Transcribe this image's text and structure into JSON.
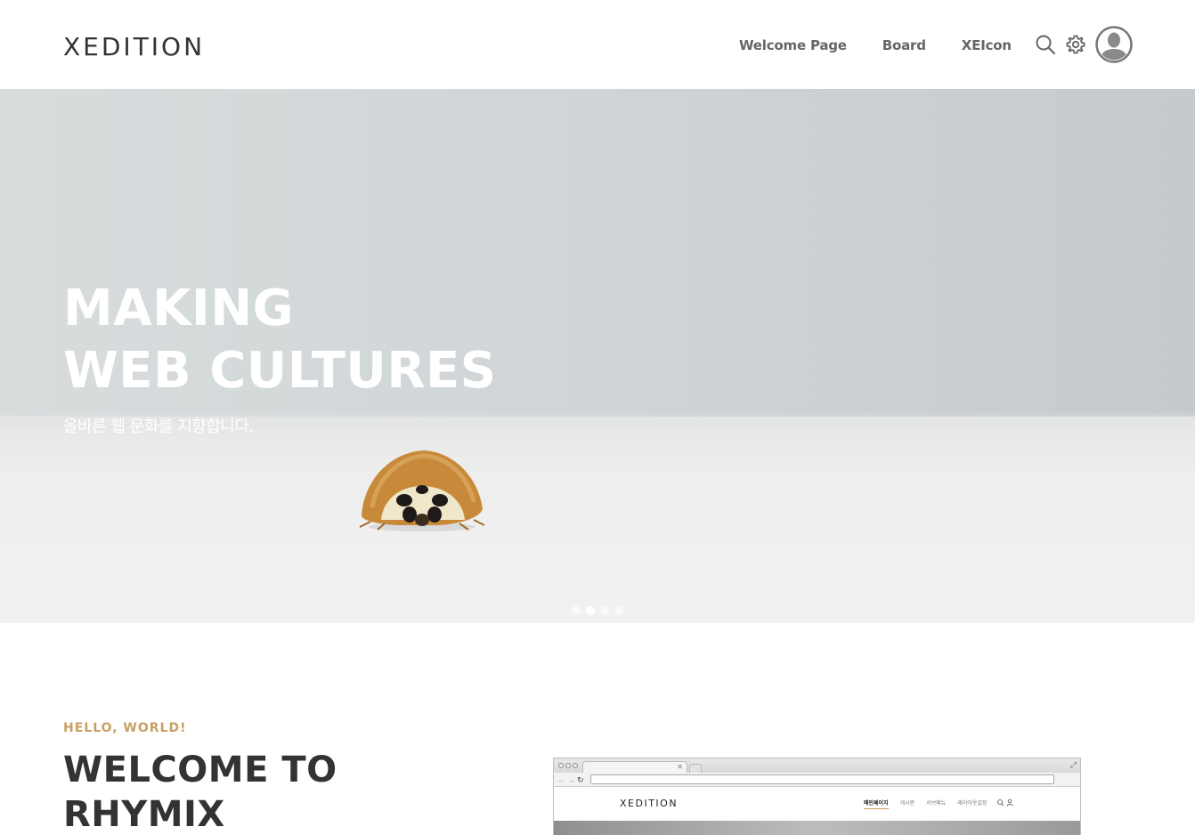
{
  "header": {
    "logo": "XEDITION",
    "nav": [
      {
        "label": "Welcome Page"
      },
      {
        "label": "Board"
      },
      {
        "label": "XEIcon"
      }
    ],
    "icons": [
      "search-icon",
      "gear-icon",
      "user-avatar-icon"
    ]
  },
  "hero": {
    "title_line1": "MAKING",
    "title_line2": "WEB CULTURES",
    "subtitle": "올바른 웹 문화를 지향합니다.",
    "slides_total": 4,
    "active_slide": 2
  },
  "welcome": {
    "eyebrow": "HELLO, WORLD!",
    "title_line1": "WELCOME TO",
    "title_line2": "RHYMIX"
  },
  "mockup": {
    "logo": "XEDITION",
    "nav": [
      "메인페이지",
      "게시판",
      "서브메뉴",
      "레이아웃설정"
    ]
  },
  "colors": {
    "accent": "#c8a063",
    "text_dark": "#333333",
    "nav_text": "#666666"
  }
}
